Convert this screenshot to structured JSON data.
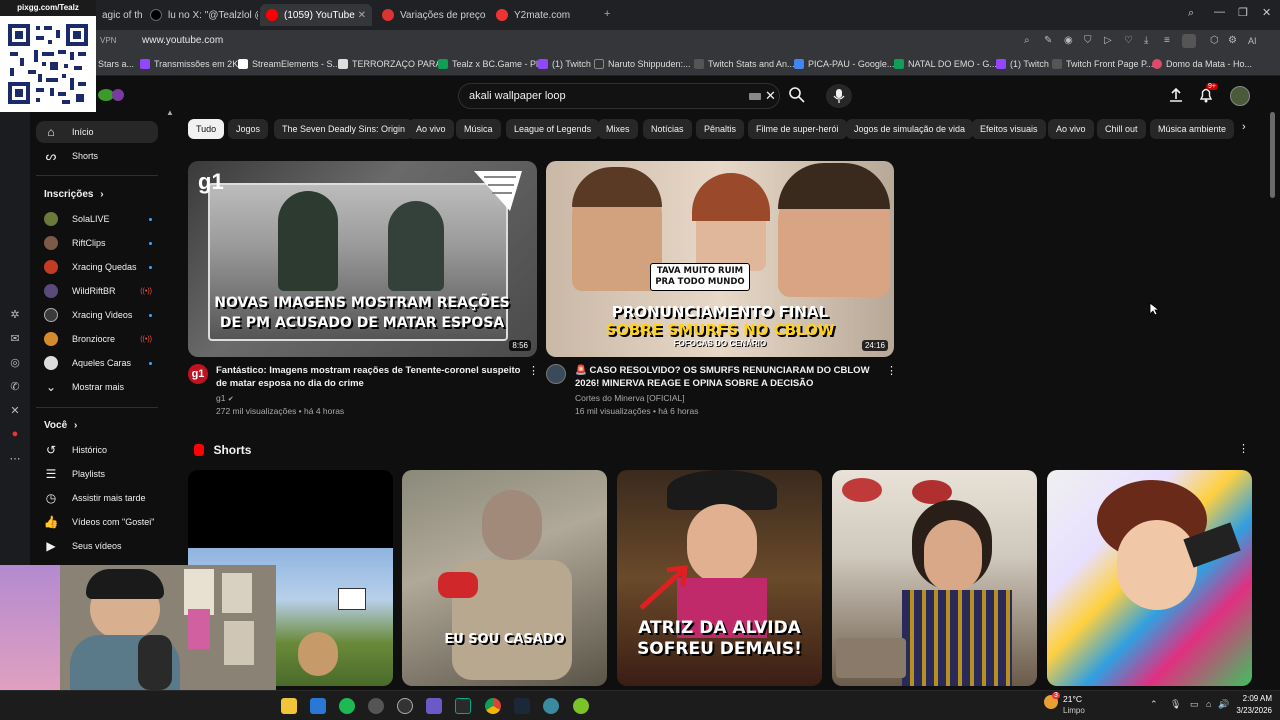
{
  "overlay": {
    "qr_label": "pixgg.com/Tealz"
  },
  "tabs": [
    {
      "label": "agic of the"
    },
    {
      "label": "lu no X: \"@Tealzlol @po"
    },
    {
      "label": "(1059) YouTube"
    },
    {
      "label": "Variações de preços | Lo"
    },
    {
      "label": "Y2mate.com"
    }
  ],
  "addressbar": {
    "vpn": "VPN",
    "url": "www.youtube.com",
    "ai": "AI"
  },
  "bookmarks": [
    "Stars a...",
    "Transmissões em 2K...",
    "StreamElements - S...",
    "TERRORZAÇO PARA...",
    "Tealz x BC.Game - Pl...",
    "(1) Twitch",
    "Naruto Shippuden:...",
    "Twitch Stats and An...",
    "PICA-PAU - Google...",
    "NATAL DO EMO - G...",
    "(1) Twitch",
    "Twitch Front Page P...",
    "Domo da Mata - Ho..."
  ],
  "search": {
    "query": "akali wallpaper loop"
  },
  "header": {
    "notification_count": "9+"
  },
  "chips": [
    "Tudo",
    "Jogos",
    "The Seven Deadly Sins: Origin",
    "Ao vivo",
    "Música",
    "League of Legends",
    "Mixes",
    "Notícias",
    "Pênaltis",
    "Filme de super-herói",
    "Jogos de simulação de vida",
    "Efeitos visuais",
    "Ao vivo",
    "Chill out",
    "Música ambiente"
  ],
  "sidebar": {
    "home": "Início",
    "shorts": "Shorts",
    "subscriptions_heading": "Inscrições",
    "subscriptions": [
      {
        "name": "SolaLIVE",
        "color": "#6a7a3a",
        "live": false
      },
      {
        "name": "RiftClips",
        "color": "#7b5a4a",
        "live": false
      },
      {
        "name": "Xracing Quedas",
        "color": "#c23b22",
        "live": false
      },
      {
        "name": "WildRiftBR",
        "color": "#5a4a7a",
        "live": true
      },
      {
        "name": "Xracing Videos",
        "color": "#3a3a3a",
        "live": false
      },
      {
        "name": "Bronziocre",
        "color": "#d68a2a",
        "live": true
      },
      {
        "name": "Aqueles Caras",
        "color": "#dddddd",
        "live": false
      }
    ],
    "show_more": "Mostrar mais",
    "you_heading": "Você",
    "you_items": [
      "Histórico",
      "Playlists",
      "Assistir mais tarde",
      "Vídeos com \"Gostei\"",
      "Seus vídeos"
    ]
  },
  "videos": [
    {
      "thumb_text": "NOVAS IMAGENS MOSTRAM REAÇÕES  DE PM ACUSADO DE MATAR ESPOSA",
      "duration": "8:56",
      "title": "Fantástico: Imagens mostram reações de Tenente-coronel suspeito de matar esposa no dia do crime",
      "channel": "g1",
      "meta": "272 mil visualizações • há 4 horas"
    },
    {
      "thumb_badge": "TAVA MUITO RUIM PRA TODO MUNDO",
      "thumb_text1": "PRONUNCIAMENTO FINAL",
      "thumb_text2": "SOBRE SMURFS NO CBLOW",
      "thumb_text3": "FOFOCAS DO CENÁRIO",
      "duration": "24:16",
      "title": "🚨 CASO RESOLVIDO? OS SMURFS RENUNCIARAM DO CBLOW 2026! MINERVA REAGE E OPINA SOBRE A DECISÃO",
      "channel": "Cortes do Minerva [OFICIAL]",
      "meta": "16 mil visualizações • há 6 horas"
    }
  ],
  "shorts_section": {
    "title": "Shorts",
    "captions": [
      "",
      "EU SOU CASADO",
      "ATRIZ DA ALVIDA SOFREU DEMAIS!",
      "",
      ""
    ]
  },
  "taskbar": {
    "temperature": "21°C",
    "weather": "Limpo",
    "weather_badge": "3",
    "time": "2:09 AM",
    "date": "3/23/2026"
  },
  "colors": {
    "yt_bg": "#0f0f0f",
    "yt_red": "#ff0000",
    "chip_bg": "#272727",
    "link_blue": "#3ea6ff"
  }
}
